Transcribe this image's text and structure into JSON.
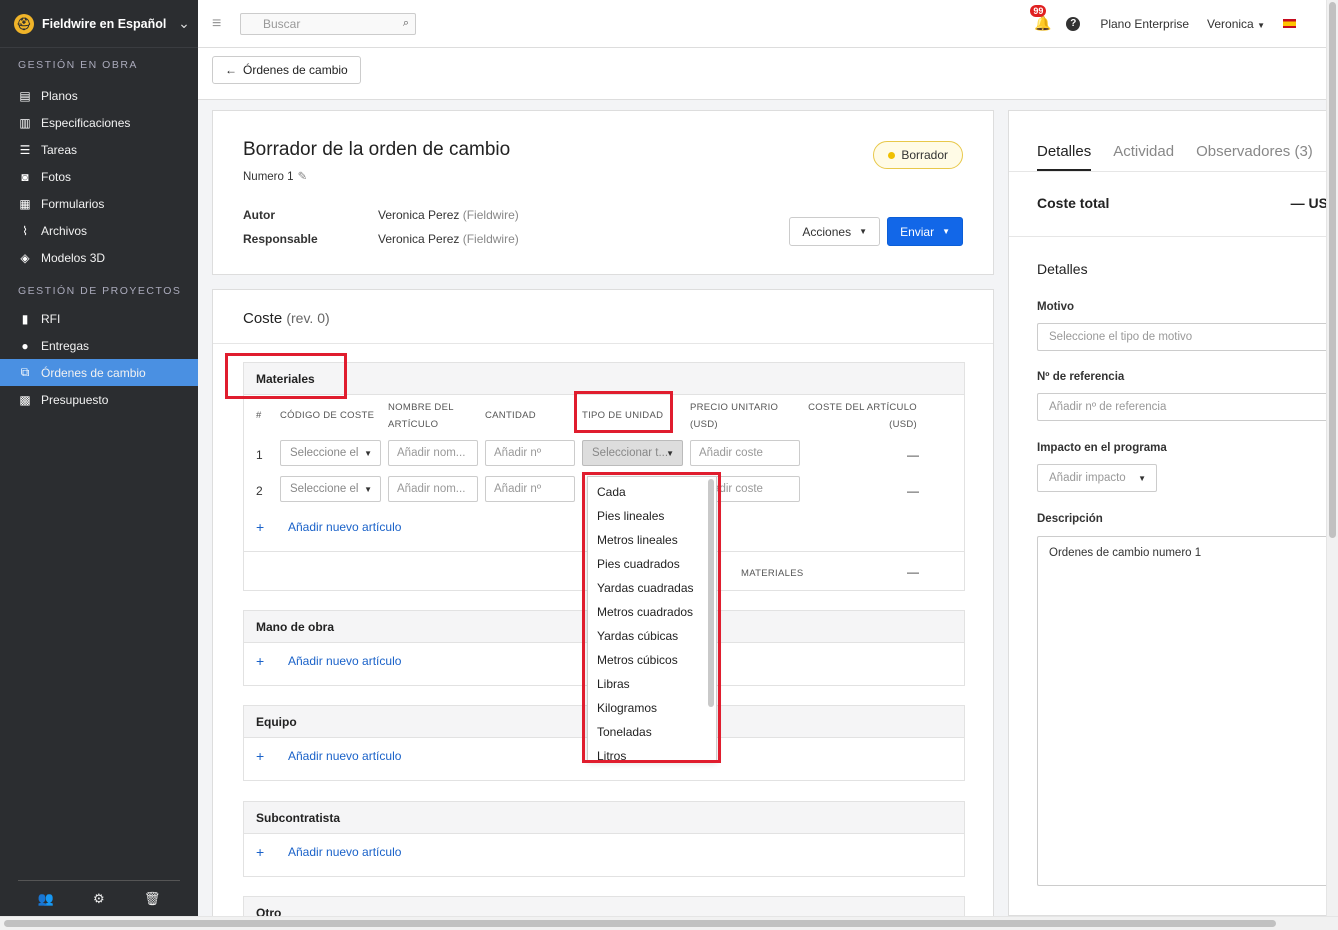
{
  "sidebar": {
    "brand": "Fieldwire en Español",
    "section1": "GESTIÓN EN OBRA",
    "items1": [
      {
        "label": "Planos",
        "icon": "blueprint-icon"
      },
      {
        "label": "Especificaciones",
        "icon": "book-icon"
      },
      {
        "label": "Tareas",
        "icon": "list-icon"
      },
      {
        "label": "Fotos",
        "icon": "camera-icon"
      },
      {
        "label": "Formularios",
        "icon": "clipboard-icon"
      },
      {
        "label": "Archivos",
        "icon": "paperclip-icon"
      },
      {
        "label": "Modelos 3D",
        "icon": "cube-icon"
      }
    ],
    "section2": "GESTIÓN DE PROYECTOS",
    "items2": [
      {
        "label": "RFI",
        "icon": "rfi-doc-icon"
      },
      {
        "label": "Entregas",
        "icon": "person-icon"
      },
      {
        "label": "Órdenes de cambio",
        "icon": "change-order-icon"
      },
      {
        "label": "Presupuesto",
        "icon": "calculator-icon"
      }
    ],
    "active": "Órdenes de cambio"
  },
  "topbar": {
    "search_placeholder": "Buscar",
    "notifications": "99",
    "plan": "Plano Enterprise",
    "user": "Veronica"
  },
  "back_button": "Órdenes de cambio",
  "change_order": {
    "title": "Borrador de la orden de cambio",
    "number": "Numero 1",
    "status": "Borrador",
    "author_label": "Autor",
    "author_name": "Veronica Perez",
    "author_org": "(Fieldwire)",
    "assignee_label": "Responsable",
    "assignee_name": "Veronica Perez",
    "assignee_org": "(Fieldwire)",
    "actions_label": "Acciones",
    "send_label": "Enviar"
  },
  "cost": {
    "title": "Coste",
    "rev": "(rev. 0)",
    "materials": {
      "title": "Materiales",
      "columns": {
        "num": "#",
        "code": "CÓDIGO DE COSTE",
        "name1": "NOMBRE DEL",
        "name2": "ARTÍCULO",
        "qty": "CANTIDAD",
        "unit": "TIPO DE UNIDAD",
        "price1": "PRECIO UNITARIO",
        "price2": "(USD)",
        "total1": "COSTE DEL ARTÍCULO",
        "total2": "(USD)"
      },
      "rows": [
        {
          "num": "1",
          "code": "Seleccione el",
          "name": "Añadir nom...",
          "qty": "Añadir nº",
          "unit": "Seleccionar t...",
          "price": "Añadir coste",
          "total": "—"
        },
        {
          "num": "2",
          "code": "Seleccione el",
          "name": "Añadir nom...",
          "qty": "Añadir nº",
          "unit": "",
          "price": "Añadir coste",
          "total": "—"
        }
      ],
      "add": "Añadir nuevo artículo",
      "subtotal_label": "MATERIALES",
      "subtotal_value": "—"
    },
    "labor": {
      "title": "Mano de obra",
      "add": "Añadir nuevo artículo"
    },
    "equipment": {
      "title": "Equipo",
      "add": "Añadir nuevo artículo"
    },
    "subcontractor": {
      "title": "Subcontratista",
      "add": "Añadir nuevo artículo"
    },
    "other": {
      "title": "Otro"
    }
  },
  "unit_dropdown": [
    "Cada",
    "Pies lineales",
    "Metros lineales",
    "Pies cuadrados",
    "Yardas cuadradas",
    "Metros cuadrados",
    "Yardas cúbicas",
    "Metros cúbicos",
    "Libras",
    "Kilogramos",
    "Toneladas",
    "Litros"
  ],
  "right_panel": {
    "tabs": [
      "Detalles",
      "Actividad",
      "Observadores (3)"
    ],
    "total_label": "Coste total",
    "total_value": "— US",
    "details_title": "Detalles",
    "reason_label": "Motivo",
    "reason_placeholder": "Seleccione el tipo de motivo",
    "ref_label": "Nº de referencia",
    "ref_placeholder": "Añadir nº de referencia",
    "impact_label": "Impacto en el programa",
    "impact_placeholder": "Añadir impacto",
    "desc_label": "Descripción",
    "desc_value": "Ordenes de cambio numero 1"
  }
}
